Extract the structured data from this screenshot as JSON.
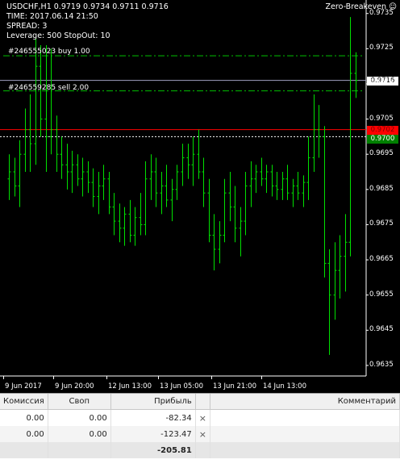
{
  "chart": {
    "symbol_line": "USDCHF,H1  0.9719 0.9734 0.9711 0.9716",
    "info_lines": [
      "TIME: 2017.06.14 21:50",
      "SPREAD: 3",
      "Leverage: 500   StopOut: 10"
    ],
    "ea_name": "Zero-Breakeven",
    "order_labels": [
      "#246555023 buy 1.00",
      "#246559285 sell 2.00"
    ],
    "price_tags": {
      "current": "0.9716",
      "red": "0.9702",
      "green": "0.9700"
    },
    "colors": {
      "candles": "#00e000",
      "red_line": "#ff0000",
      "green_tag": "#008000",
      "order_line": "#00c000"
    }
  },
  "chart_data": {
    "type": "bar",
    "y_ticks": [
      "0.9735",
      "0.9725",
      "0.9715",
      "0.9705",
      "0.9695",
      "0.9685",
      "0.9675",
      "0.9665",
      "0.9655",
      "0.9645",
      "0.9635"
    ],
    "x_ticks": [
      "9 Jun 2017",
      "9 Jun 20:00",
      "12 Jun 13:00",
      "13 Jun 05:00",
      "13 Jun 21:00",
      "14 Jun 13:00"
    ],
    "ylim": [
      0.9632,
      0.9737
    ],
    "ohlc": [
      [
        0.9688,
        0.9695,
        0.9682,
        0.969
      ],
      [
        0.969,
        0.9694,
        0.9683,
        0.9686
      ],
      [
        0.9686,
        0.9699,
        0.968,
        0.9695
      ],
      [
        0.9695,
        0.9708,
        0.969,
        0.9702
      ],
      [
        0.9702,
        0.9712,
        0.969,
        0.9698
      ],
      [
        0.9698,
        0.9728,
        0.9692,
        0.972
      ],
      [
        0.972,
        0.9726,
        0.97,
        0.9705
      ],
      [
        0.9705,
        0.9726,
        0.969,
        0.97
      ],
      [
        0.97,
        0.9725,
        0.9695,
        0.9702
      ],
      [
        0.9702,
        0.9706,
        0.969,
        0.9695
      ],
      [
        0.9695,
        0.97,
        0.9688,
        0.9692
      ],
      [
        0.9692,
        0.9698,
        0.9685,
        0.969
      ],
      [
        0.969,
        0.9696,
        0.9684,
        0.9692
      ],
      [
        0.9692,
        0.9695,
        0.9686,
        0.9688
      ],
      [
        0.9688,
        0.9694,
        0.9683,
        0.969
      ],
      [
        0.969,
        0.9693,
        0.9684,
        0.9687
      ],
      [
        0.9687,
        0.9691,
        0.968,
        0.9683
      ],
      [
        0.9683,
        0.969,
        0.9678,
        0.9686
      ],
      [
        0.9686,
        0.9692,
        0.9682,
        0.9688
      ],
      [
        0.9688,
        0.969,
        0.9678,
        0.968
      ],
      [
        0.968,
        0.9684,
        0.9672,
        0.9676
      ],
      [
        0.9676,
        0.9681,
        0.967,
        0.9674
      ],
      [
        0.9674,
        0.968,
        0.9669,
        0.9678
      ],
      [
        0.9678,
        0.9682,
        0.967,
        0.9672
      ],
      [
        0.9672,
        0.968,
        0.9669,
        0.9677
      ],
      [
        0.9677,
        0.9684,
        0.9672,
        0.9675
      ],
      [
        0.9675,
        0.9693,
        0.9672,
        0.9688
      ],
      [
        0.9688,
        0.9695,
        0.9682,
        0.969
      ],
      [
        0.969,
        0.9694,
        0.968,
        0.9684
      ],
      [
        0.9684,
        0.969,
        0.9678,
        0.9686
      ],
      [
        0.9686,
        0.9692,
        0.968,
        0.9682
      ],
      [
        0.9682,
        0.9688,
        0.9676,
        0.9685
      ],
      [
        0.9685,
        0.9692,
        0.9682,
        0.969
      ],
      [
        0.969,
        0.9698,
        0.9686,
        0.9694
      ],
      [
        0.9694,
        0.9698,
        0.9688,
        0.9692
      ],
      [
        0.9692,
        0.97,
        0.9686,
        0.9695
      ],
      [
        0.9695,
        0.9702,
        0.9688,
        0.969
      ],
      [
        0.969,
        0.9694,
        0.968,
        0.9684
      ],
      [
        0.9684,
        0.9688,
        0.967,
        0.9672
      ],
      [
        0.9672,
        0.9678,
        0.9662,
        0.9668
      ],
      [
        0.9668,
        0.9676,
        0.9664,
        0.9672
      ],
      [
        0.9672,
        0.9688,
        0.967,
        0.9684
      ],
      [
        0.9684,
        0.969,
        0.9676,
        0.968
      ],
      [
        0.968,
        0.9686,
        0.967,
        0.9674
      ],
      [
        0.9674,
        0.968,
        0.9666,
        0.9676
      ],
      [
        0.9676,
        0.969,
        0.9672,
        0.9686
      ],
      [
        0.9686,
        0.9693,
        0.968,
        0.9688
      ],
      [
        0.9688,
        0.9692,
        0.9684,
        0.969
      ],
      [
        0.969,
        0.9694,
        0.9686,
        0.9688
      ],
      [
        0.9688,
        0.9692,
        0.9684,
        0.969
      ],
      [
        0.969,
        0.9692,
        0.9683,
        0.9686
      ],
      [
        0.9686,
        0.969,
        0.9682,
        0.9685
      ],
      [
        0.9685,
        0.969,
        0.9682,
        0.9688
      ],
      [
        0.9688,
        0.9692,
        0.9682,
        0.9684
      ],
      [
        0.9684,
        0.9688,
        0.968,
        0.9686
      ],
      [
        0.9686,
        0.969,
        0.9682,
        0.9684
      ],
      [
        0.9684,
        0.9689,
        0.968,
        0.9687
      ],
      [
        0.9687,
        0.97,
        0.9682,
        0.9694
      ],
      [
        0.9694,
        0.9712,
        0.969,
        0.9702
      ],
      [
        0.9702,
        0.9709,
        0.9694,
        0.97
      ],
      [
        0.97,
        0.9703,
        0.966,
        0.9664
      ],
      [
        0.9664,
        0.9668,
        0.9638,
        0.9655
      ],
      [
        0.9655,
        0.967,
        0.9648,
        0.9662
      ],
      [
        0.9662,
        0.9672,
        0.9654,
        0.9666
      ],
      [
        0.9666,
        0.9678,
        0.9656,
        0.967
      ],
      [
        0.967,
        0.9734,
        0.9666,
        0.9718
      ],
      [
        0.9718,
        0.9724,
        0.9711,
        0.9716
      ]
    ],
    "order_levels": [
      0.9723,
      0.9713
    ],
    "current_price": 0.9716,
    "red_level": 0.9702,
    "green_level": 0.97,
    "grid": false
  },
  "terminal": {
    "columns": [
      "Комиссия",
      "Своп",
      "Прибыль",
      "",
      "Комментарий"
    ],
    "rows": [
      {
        "commission": "0.00",
        "swap": "0.00",
        "profit": "-82.34",
        "close": "×"
      },
      {
        "commission": "0.00",
        "swap": "0.00",
        "profit": "-123.47",
        "close": "×"
      }
    ],
    "total": "-205.81"
  }
}
